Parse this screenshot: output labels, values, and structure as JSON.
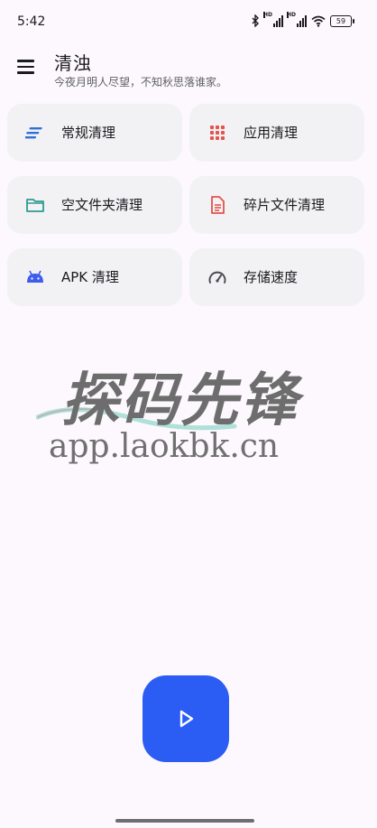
{
  "status_bar": {
    "time": "5:42",
    "signal_1_label": "HD",
    "signal_2_label": "HD",
    "battery_level": "59"
  },
  "header": {
    "title": "清浊",
    "subtitle": "今夜月明人尽望，不知秋思落谁家。"
  },
  "cards": [
    {
      "label": "常规清理",
      "icon": "lines-icon",
      "color": "#2f6fd8"
    },
    {
      "label": "应用清理",
      "icon": "app-grid-icon",
      "color": "#e5534b"
    },
    {
      "label": "空文件夹清理",
      "icon": "folder-icon",
      "color": "#2f9c8f"
    },
    {
      "label": "碎片文件清理",
      "icon": "document-icon",
      "color": "#e5534b"
    },
    {
      "label": "APK 清理",
      "icon": "android-icon",
      "color": "#3d5cf0"
    },
    {
      "label": "存储速度",
      "icon": "speedometer-icon",
      "color": "#4a4a4f"
    }
  ],
  "watermark": {
    "brand": "探码先锋",
    "url": "app.laokbk.cn"
  },
  "fab": {
    "icon": "play-icon",
    "color": "#2b5df5"
  }
}
